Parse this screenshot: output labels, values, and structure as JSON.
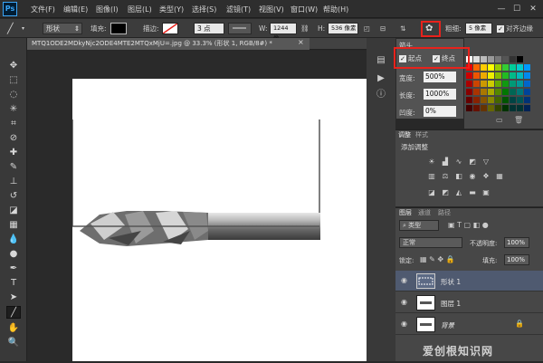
{
  "app": {
    "logo": "Ps"
  },
  "menu": [
    "文件(F)",
    "编辑(E)",
    "图像(I)",
    "图层(L)",
    "类型(Y)",
    "选择(S)",
    "滤镜(T)",
    "视图(V)",
    "窗口(W)",
    "帮助(H)"
  ],
  "window_controls": [
    "—",
    "☐",
    "✕"
  ],
  "options": {
    "shape_mode": "形状",
    "fill_label": "填充:",
    "stroke_label": "描边:",
    "stroke_size": "3 点",
    "w_label": "W:",
    "w_value": "1244 像",
    "h_label": "H:",
    "h_value": "536 像素",
    "weight_label": "粗细:",
    "weight_value": "5 像素",
    "align_edges_label": "对齐边缘"
  },
  "document": {
    "tab_title": "MTQ1ODE2MDkyNjc2ODE4MTE2MTQxMjU=.jpg @ 33.3% (形状 1, RGB/8#) *",
    "close": "×"
  },
  "arrow_popup": {
    "title": "箭头",
    "start_label": "起点",
    "end_label": "终点",
    "start_checked": true,
    "end_checked": true,
    "width_label": "宽度:",
    "width_value": "500%",
    "length_label": "长度:",
    "length_value": "1000%",
    "concavity_label": "凹度:",
    "concavity_value": "0%"
  },
  "adjustments": {
    "tabs": [
      "调整",
      "样式"
    ],
    "title": "添加调整"
  },
  "layers": {
    "tabs": [
      "图层",
      "通道",
      "路径"
    ],
    "filter_kind": "类型",
    "blend_mode": "正常",
    "opacity_label": "不透明度:",
    "opacity_value": "100%",
    "lock_label": "锁定:",
    "fill_label": "填充:",
    "fill_value": "100%",
    "items": [
      {
        "name": "形状 1",
        "selected": true
      },
      {
        "name": "图层 1",
        "selected": false
      },
      {
        "name": "背景",
        "selected": false,
        "locked": true
      }
    ]
  },
  "watermark": "爱创根知识网",
  "colors": {
    "highlight": "#e8221c",
    "selected_layer": "#4f5a70"
  }
}
